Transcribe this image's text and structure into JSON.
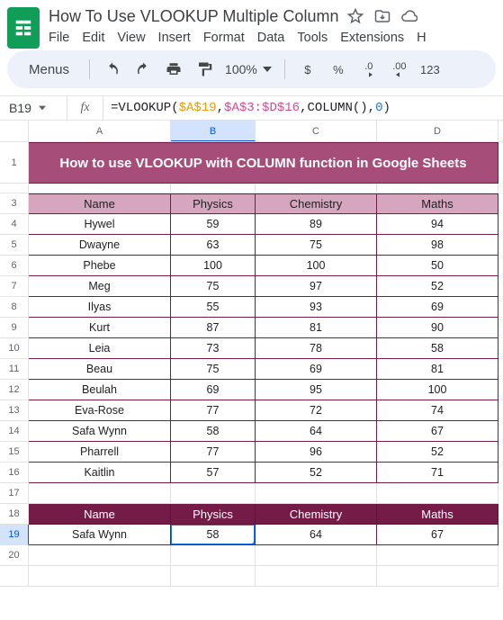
{
  "doc": {
    "title": "How To Use VLOOKUP Multiple Column"
  },
  "menus": {
    "file": "File",
    "edit": "Edit",
    "view": "View",
    "insert": "Insert",
    "format": "Format",
    "data": "Data",
    "tools": "Tools",
    "extensions": "Extensions",
    "help": "H"
  },
  "toolbar": {
    "search_label": "Menus",
    "zoom": "100%",
    "currency": "$",
    "percent": "%",
    "dec_dec": ".0",
    "dec_inc": ".00",
    "num_fmt": "123"
  },
  "namebox": "B19",
  "formula": {
    "fn": "=VLOOKUP(",
    "ref1": "$A$19",
    "c1": ",",
    "ref2": "$A$3:$D$16",
    "c2": ",COLUMN(),",
    "num": "0",
    "close": ")"
  },
  "col_headers": {
    "A": "A",
    "B": "B",
    "C": "C",
    "D": "D"
  },
  "row_headers": [
    "1",
    "3",
    "4",
    "5",
    "6",
    "7",
    "8",
    "9",
    "10",
    "11",
    "12",
    "13",
    "14",
    "15",
    "16",
    "17",
    "18",
    "19",
    "20"
  ],
  "banner": "How to use VLOOKUP with COLUMN function in Google Sheets",
  "table": {
    "headers": {
      "name": "Name",
      "physics": "Physics",
      "chemistry": "Chemistry",
      "maths": "Maths"
    },
    "rows": [
      {
        "name": "Hywel",
        "physics": "59",
        "chemistry": "89",
        "maths": "94"
      },
      {
        "name": "Dwayne",
        "physics": "63",
        "chemistry": "75",
        "maths": "98"
      },
      {
        "name": "Phebe",
        "physics": "100",
        "chemistry": "100",
        "maths": "50"
      },
      {
        "name": "Meg",
        "physics": "75",
        "chemistry": "97",
        "maths": "52"
      },
      {
        "name": "Ilyas",
        "physics": "55",
        "chemistry": "93",
        "maths": "69"
      },
      {
        "name": "Kurt",
        "physics": "87",
        "chemistry": "81",
        "maths": "90"
      },
      {
        "name": "Leia",
        "physics": "73",
        "chemistry": "78",
        "maths": "58"
      },
      {
        "name": "Beau",
        "physics": "75",
        "chemistry": "69",
        "maths": "81"
      },
      {
        "name": "Beulah",
        "physics": "69",
        "chemistry": "95",
        "maths": "100"
      },
      {
        "name": "Eva-Rose",
        "physics": "77",
        "chemistry": "72",
        "maths": "74"
      },
      {
        "name": "Safa Wynn",
        "physics": "58",
        "chemistry": "64",
        "maths": "67"
      },
      {
        "name": "Pharrell",
        "physics": "77",
        "chemistry": "96",
        "maths": "52"
      },
      {
        "name": "Kaitlin",
        "physics": "57",
        "chemistry": "52",
        "maths": "71"
      }
    ]
  },
  "lookup": {
    "headers": {
      "name": "Name",
      "physics": "Physics",
      "chemistry": "Chemistry",
      "maths": "Maths"
    },
    "row": {
      "name": "Safa Wynn",
      "physics": "58",
      "chemistry": "64",
      "maths": "67"
    }
  },
  "chart_data": {
    "type": "table",
    "title": "How to use VLOOKUP with COLUMN function in Google Sheets",
    "columns": [
      "Name",
      "Physics",
      "Chemistry",
      "Maths"
    ],
    "rows": [
      [
        "Hywel",
        59,
        89,
        94
      ],
      [
        "Dwayne",
        63,
        75,
        98
      ],
      [
        "Phebe",
        100,
        100,
        50
      ],
      [
        "Meg",
        75,
        97,
        52
      ],
      [
        "Ilyas",
        55,
        93,
        69
      ],
      [
        "Kurt",
        87,
        81,
        90
      ],
      [
        "Leia",
        73,
        78,
        58
      ],
      [
        "Beau",
        75,
        69,
        81
      ],
      [
        "Beulah",
        69,
        95,
        100
      ],
      [
        "Eva-Rose",
        77,
        72,
        74
      ],
      [
        "Safa Wynn",
        58,
        64,
        67
      ],
      [
        "Pharrell",
        77,
        96,
        52
      ],
      [
        "Kaitlin",
        57,
        52,
        71
      ]
    ],
    "lookup_result": [
      "Safa Wynn",
      58,
      64,
      67
    ]
  }
}
